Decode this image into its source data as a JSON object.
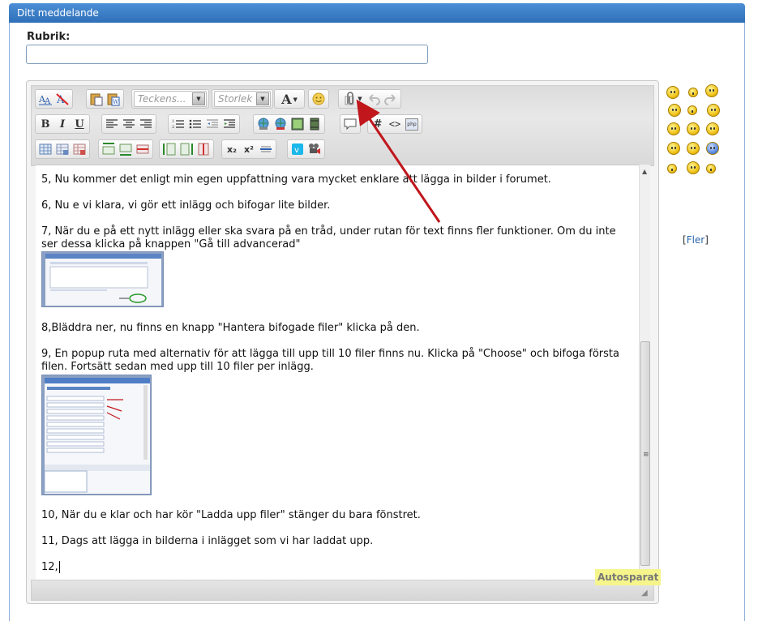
{
  "panel": {
    "title": "Ditt meddelande"
  },
  "form": {
    "rubrik_label": "Rubrik:",
    "rubrik_value": ""
  },
  "toolbar": {
    "font_select": "Teckens...",
    "size_select": "Storlek",
    "text_color_glyph": "A",
    "bold": "B",
    "italic": "I",
    "underline": "U",
    "hash": "#",
    "code": "<>",
    "php": "php",
    "sub": "x₂",
    "sup": "x²"
  },
  "content": {
    "lines": [
      "5, Nu kommer det enligt min egen uppfattning vara mycket enklare att lägga in bilder i forumet.",
      "6, Nu e vi klara, vi gör ett inlägg och bifogar lite bilder.",
      "7, När du e på ett nytt inlägg eller ska svara på en tråd, under rutan för text finns fler funktioner. Om du inte ser dessa klicka på knappen \"Gå till advancerad\"",
      "8,Bläddra ner, nu finns en knapp \"Hantera bifogade filer\" klicka på den.",
      "9, En popup ruta med alternativ för att lägga till upp till 10 filer finns nu. Klicka på \"Choose\" och bifoga första filen. Fortsätt sedan med upp till 10 filer per inlägg.",
      "10, När du e klar och har kör \"Ladda upp filer\" stänger du bara fönstret.",
      "11, Dags att lägga in bilderna i inlägget som vi har laddat upp.",
      "12,"
    ]
  },
  "status": {
    "autosave": "Autosparat"
  },
  "smilies": {
    "more_link": "Fler"
  },
  "colors": {
    "header": "#3a7bc8",
    "arrow": "#c0161c",
    "autosave_bg": "#f5f58c"
  }
}
